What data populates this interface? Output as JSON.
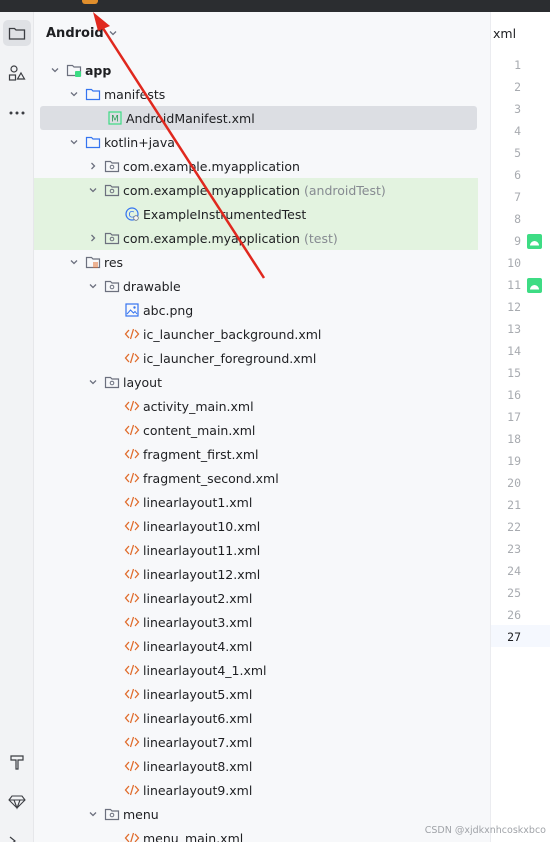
{
  "panel": {
    "view_mode": "Android"
  },
  "editor": {
    "tab_label": "xml",
    "line_numbers": [
      "1",
      "2",
      "3",
      "4",
      "5",
      "6",
      "7",
      "8",
      "9",
      "10",
      "11",
      "12",
      "13",
      "14",
      "15",
      "16",
      "17",
      "18",
      "19",
      "20",
      "21",
      "22",
      "23",
      "24",
      "25",
      "26",
      "27"
    ],
    "current_line": "27"
  },
  "tree": {
    "app": "app",
    "manifests": "manifests",
    "android_manifest": "AndroidManifest.xml",
    "kotlin_java": "kotlin+java",
    "pkg_main": "com.example.myapplication",
    "pkg_android_test": "com.example.myapplication",
    "pkg_android_test_suffix": "(androidTest)",
    "example_instrumented_test": "ExampleInstrumentedTest",
    "pkg_test": "com.example.myapplication",
    "pkg_test_suffix": "(test)",
    "res": "res",
    "drawable": "drawable",
    "abc_png": "abc.png",
    "ic_launcher_background": "ic_launcher_background.xml",
    "ic_launcher_foreground": "ic_launcher_foreground.xml",
    "layout": "layout",
    "layout_files": [
      "activity_main.xml",
      "content_main.xml",
      "fragment_first.xml",
      "fragment_second.xml",
      "linearlayout1.xml",
      "linearlayout10.xml",
      "linearlayout11.xml",
      "linearlayout12.xml",
      "linearlayout2.xml",
      "linearlayout3.xml",
      "linearlayout4.xml",
      "linearlayout4_1.xml",
      "linearlayout5.xml",
      "linearlayout6.xml",
      "linearlayout7.xml",
      "linearlayout8.xml",
      "linearlayout9.xml"
    ],
    "menu": "menu",
    "menu_main": "menu_main.xml"
  },
  "watermark": "CSDN @xjdkxnhcoskxbco",
  "colors": {
    "accent_green": "#3ddc84",
    "xml_orange": "#e06c2c",
    "folder_blue": "#3574f0",
    "annotation_red": "#e0281e"
  }
}
